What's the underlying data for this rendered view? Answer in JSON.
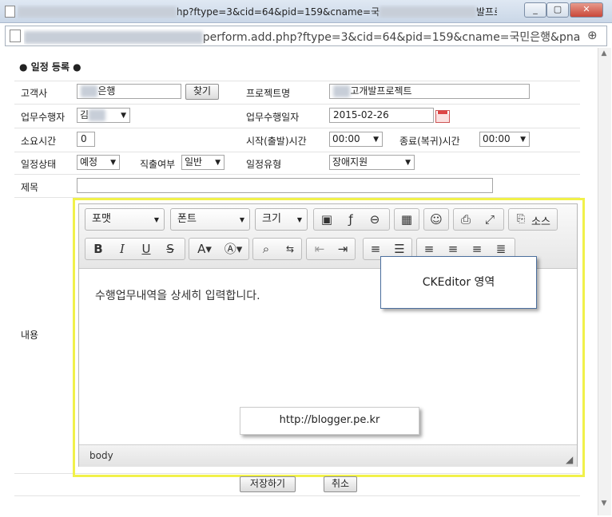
{
  "window": {
    "title": "hp?ftype=3&cid=64&pid=159&cname=국",
    "title_tail": "발프로...",
    "url_path": "perform.add.php?ftype=3&cid=64&pid=159&cname=국민은행&pna",
    "min": "▭",
    "max": "▢",
    "close": "✕"
  },
  "form": {
    "section_title": "일정 등록",
    "client_label": "고객사",
    "client_value": "은행",
    "find_button": "찾기",
    "project_label": "프로젝트명",
    "project_value": "고개발프로젝트",
    "worker_label": "업무수행자",
    "worker_value": "김",
    "work_date_label": "업무수행일자",
    "work_date_value": "2015-02-26",
    "duration_label": "소요시간",
    "duration_value": "0",
    "start_label": "시작(출발)시간",
    "start_value": "00:00",
    "end_label": "종료(복귀)시간",
    "end_value": "00:00",
    "status_label": "일정상태",
    "status_value": "예정",
    "direct_label": "직출여부",
    "direct_value": "일반",
    "type_label": "일정유형",
    "type_value": "장애지원",
    "subject_label": "제목",
    "content_label": "내용",
    "save_button": "저장하기",
    "cancel_button": "취소"
  },
  "editor": {
    "format_combo": "포맷",
    "font_combo": "폰트",
    "size_combo": "크기",
    "source_button": "소스",
    "content_text": "수행업무내역을 상세히 입력합니다.",
    "footer_path": "body",
    "callout_text": "CKEditor 영역",
    "watermark": "http://blogger.pe.kr"
  }
}
